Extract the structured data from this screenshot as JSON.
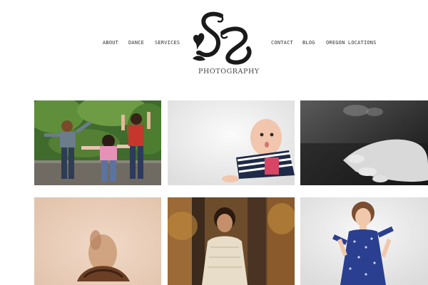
{
  "nav": {
    "left": [
      {
        "label": "ABOUT"
      },
      {
        "label": "DANCE"
      },
      {
        "label": "SERVICES"
      }
    ],
    "right": [
      {
        "label": "CONTACT"
      },
      {
        "label": "BLOG"
      },
      {
        "label": "OREGON LOCATIONS"
      }
    ]
  },
  "logo": {
    "monogram": "SZ",
    "text": "PHOTOGRAPHY",
    "icon": "sz-monogram-logo-icon"
  },
  "gallery": {
    "photos": [
      {
        "subject": "three-kids-jumping-photo"
      },
      {
        "subject": "baby-crawling-photo"
      },
      {
        "subject": "baby-hand-bw-photo"
      },
      {
        "subject": "curly-hair-photo"
      },
      {
        "subject": "woman-lace-dress-photo"
      },
      {
        "subject": "girl-blue-dress-photo"
      }
    ]
  },
  "colors": {
    "background": "#ffffff",
    "nav_text": "#333333",
    "logo": "#1a1a1a"
  }
}
